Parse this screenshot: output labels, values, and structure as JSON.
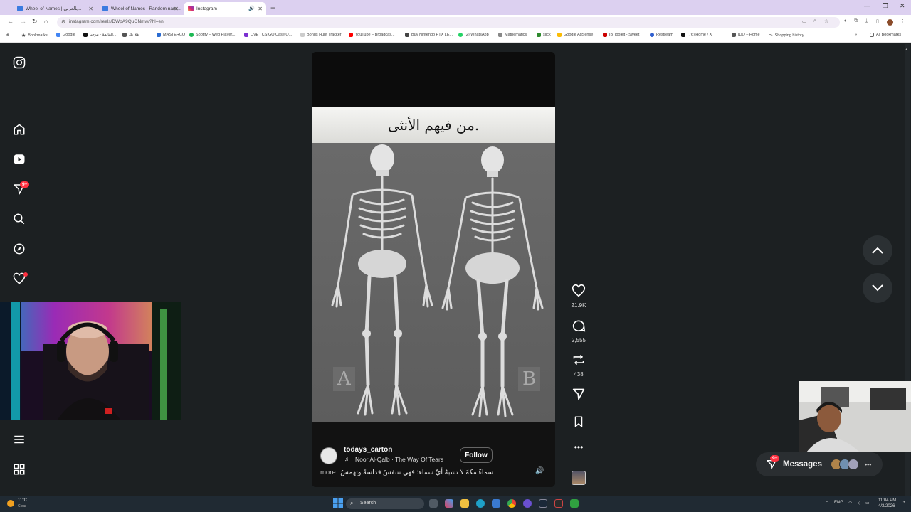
{
  "browser": {
    "tabs": [
      {
        "title": "Wheel of Names | بالعربي...",
        "active": false
      },
      {
        "title": "Wheel of Names | Random nam...",
        "active": false
      },
      {
        "title": "Instagram",
        "active": true
      }
    ],
    "url": "instagram.com/reels/DWpA9QuONmw/?hl=en",
    "bookmarks": [
      "Bookmarks",
      "Google",
      "القائمة - مرحبا...",
      "هلا بك",
      "MASTERCO",
      "Spotify – Web Player...",
      "CVE | CS:GO Case O...",
      "Bonus Hunt Tracker",
      "YouTube – Broadcas...",
      "Buy Nintendo PTX LE...",
      "(2) WhatsApp",
      "Mathematics",
      "slick",
      "Google AdSense",
      "IB Toolkit - Sweet",
      "Restream",
      "(76) Home / X",
      "IDO – Home",
      "Shopping history"
    ],
    "all_bookmarks": "All Bookmarks"
  },
  "sidebar": {
    "notification_badge": "9+"
  },
  "reel": {
    "banner_text": "من فيهم الأنثى.",
    "label_a": "A",
    "label_b": "B",
    "author": "todays_carton",
    "music": "Noor Al-Qalb · The Way Of Tears",
    "follow_label": "Follow",
    "caption": "سماءٌ مكةَ لا تشبهُ أيِّ سماء؛ فهي تتنفسُ قداسةً وتهمسُ ...",
    "more_label": "more"
  },
  "actions": {
    "likes": "21.9K",
    "comments": "2,555",
    "reposts": "438"
  },
  "messages": {
    "label": "Messages",
    "badge": "9+"
  },
  "taskbar": {
    "weather_temp": "11°C",
    "weather_desc": "Clear",
    "search_placeholder": "Search",
    "lang": "ENG",
    "time": "11:04 PM",
    "date": "4/3/2026"
  },
  "colors": {
    "badge_red": "#ff3040",
    "tabbar": "#dcd0f0",
    "page_bg": "#1c2022"
  }
}
